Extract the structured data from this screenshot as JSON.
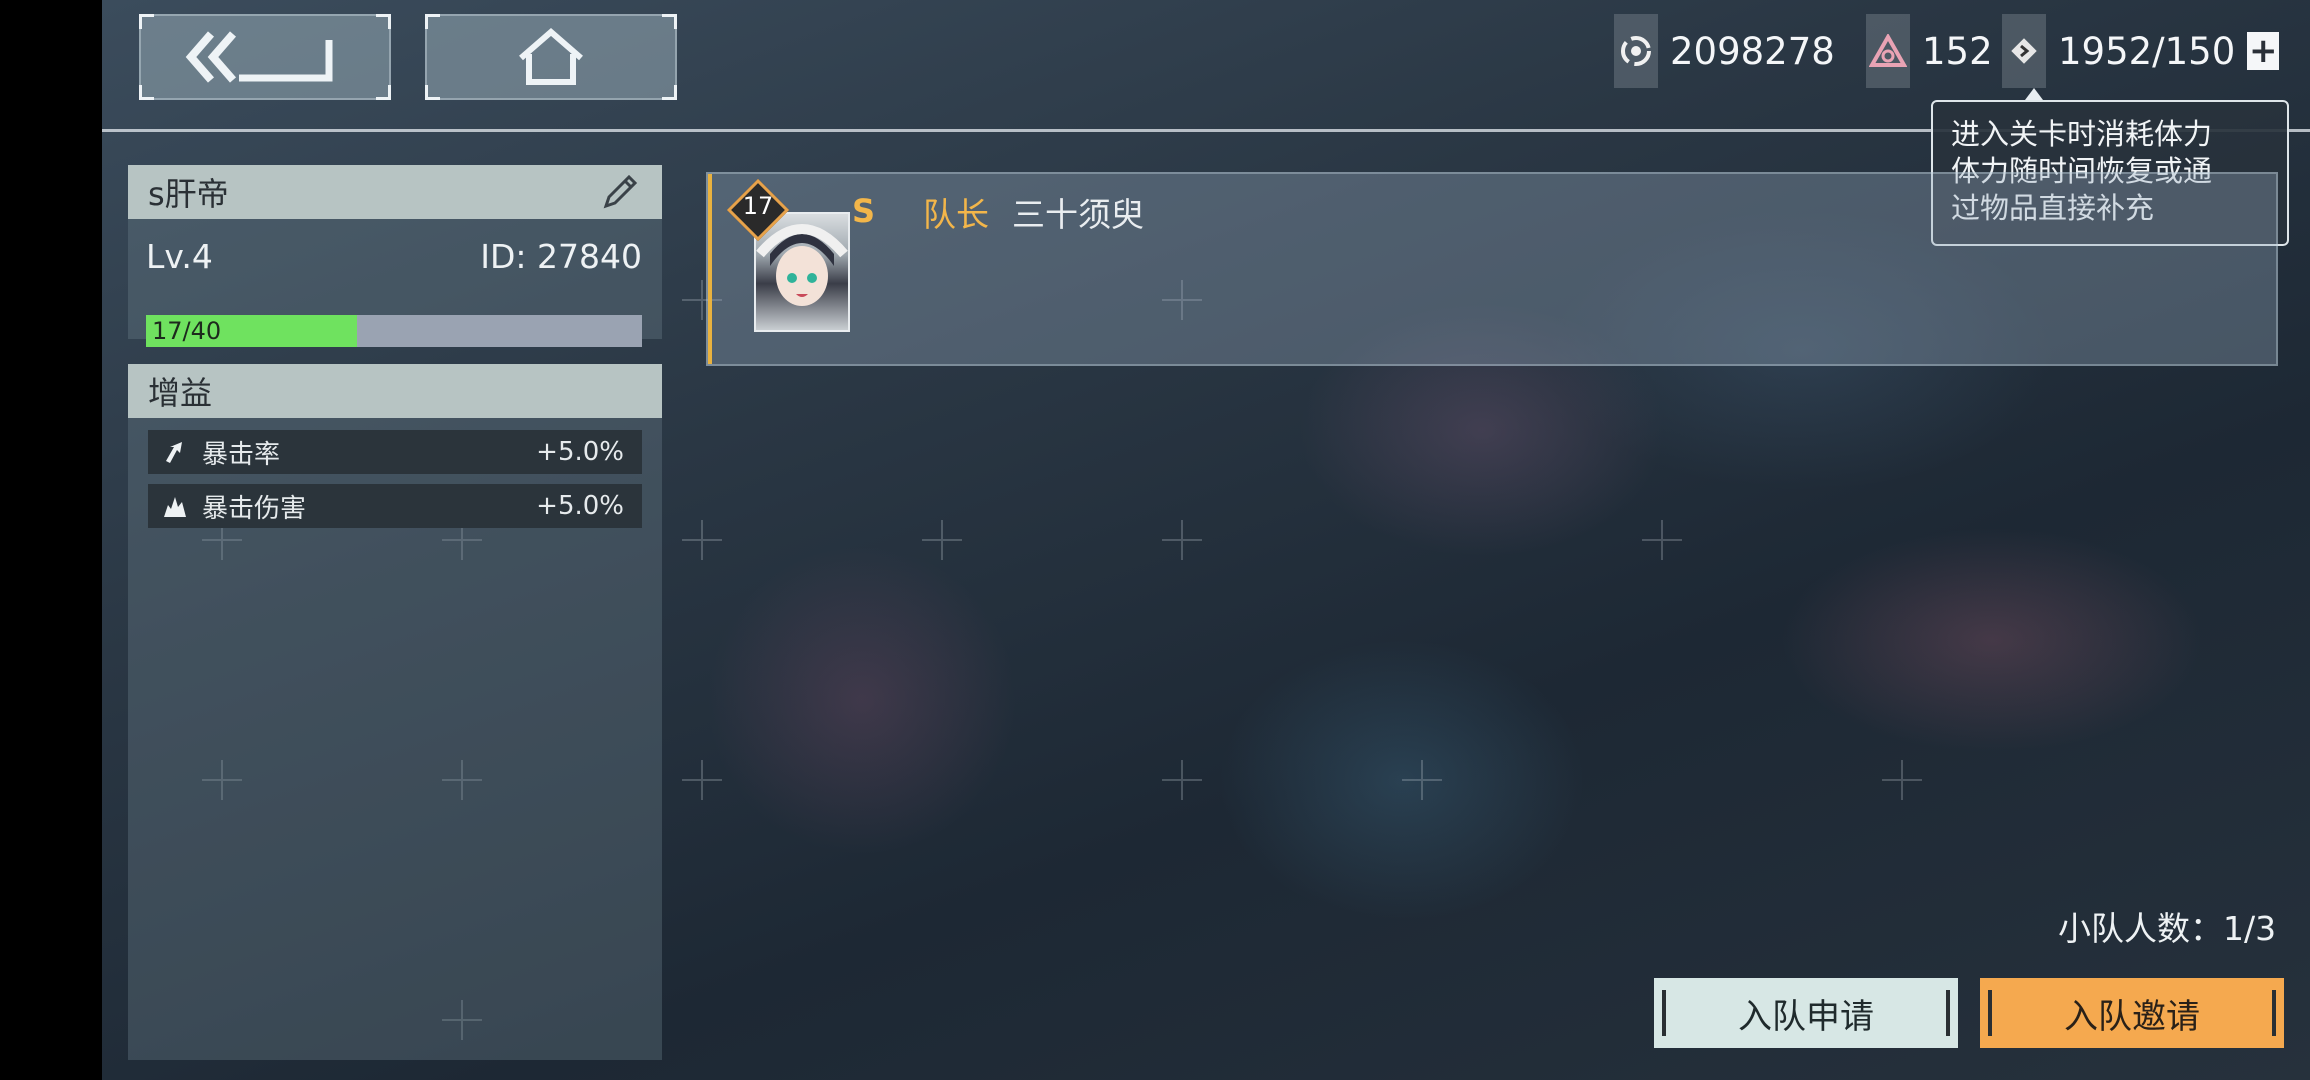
{
  "nav": {
    "back_icon": "double-chevron-back-icon",
    "home_icon": "home-icon"
  },
  "resources": {
    "coins": {
      "icon": "coin-icon",
      "value": "2098278"
    },
    "gems": {
      "icon": "crystal-icon",
      "value": "152"
    },
    "stamina": {
      "icon": "stamina-icon",
      "value": "1952/150",
      "add_label": "+"
    }
  },
  "tooltip": {
    "lines": [
      "进入关卡时消耗体力",
      "体力随时间恢复或通",
      "过物品直接补充"
    ]
  },
  "profile": {
    "name": "s肝帝",
    "level": "Lv.4",
    "id": "ID: 27840",
    "xp_text": "17/40",
    "xp_fraction": 0.425
  },
  "buffs": {
    "title": "增益",
    "items": [
      {
        "label": "暴击率",
        "value": "+5.0%"
      },
      {
        "label": "暴击伤害",
        "value": "+5.0%"
      }
    ]
  },
  "team": {
    "members": [
      {
        "level": "17",
        "rank": "S",
        "role": "队长",
        "name": "三十须臾"
      }
    ],
    "count_text": "小队人数：1/3"
  },
  "actions": {
    "apply_label": "入队申请",
    "invite_label": "入队邀请"
  },
  "colors": {
    "accent": "#f3b64a",
    "xp_green": "#6fe25f",
    "invite_btn": "#f5a94f",
    "apply_btn": "#d7e7e5"
  }
}
